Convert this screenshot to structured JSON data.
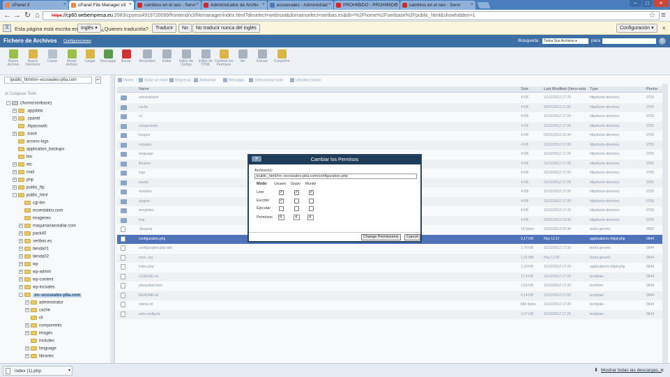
{
  "browser": {
    "tabs": [
      {
        "label": "cPanel X",
        "color": "#e7874b"
      },
      {
        "label": "cPanel File Manager v3",
        "color": "#e7874b"
      },
      {
        "label": "cambios en el seo - Servi",
        "color": "#cc2a2a"
      },
      {
        "label": "Administrador de Archiv",
        "color": "#cc2a2a"
      },
      {
        "label": "ecosenales - Administrad",
        "color": "#4a78b8"
      },
      {
        "label": "PROHIBIDO - PROHIBIDO",
        "color": "#cc2a2a"
      },
      {
        "label": "cambios en el seo - Servi",
        "color": "#cc2a2a"
      }
    ],
    "url_proto": "https",
    "url_host": "://cp60.webempresa.eu",
    "url_rest": ":2083/cpsess4919720099/frontend/x3/filemanager/index.html?dirselect=webroot&domainselect=seribas.es&dir=%2Fhome%2Fseribase%2Fpublic_html&showhidden=1"
  },
  "translate": {
    "prefix": "Esta página está escrita en",
    "language": "inglés",
    "question": "¿Quieres traducirla?",
    "translate_btn": "Traducir",
    "no_btn": "No",
    "never_btn": "No traducir nunca del inglés",
    "options_btn": "Configuración"
  },
  "app": {
    "title": "Fichero de Archivos",
    "settings_link": "Configuraciones",
    "search_label": "Búsqueda",
    "search_scope": "Todos Sus Archivos",
    "search_for": "para"
  },
  "toolbar": [
    {
      "name": "new-file",
      "label": "Nuevo Archivo",
      "color": "#9bbf4a"
    },
    {
      "name": "new-folder",
      "label": "Nuevo Directorio",
      "color": "#d9b64a"
    },
    {
      "name": "copy",
      "label": "Copiar",
      "color": "#b8c2cc"
    },
    {
      "name": "move",
      "label": "Mover Archivo",
      "color": "#9bbf4a"
    },
    {
      "name": "upload",
      "label": "Cargar",
      "color": "#d9b64a"
    },
    {
      "name": "download",
      "label": "Descargar",
      "color": "#5a9a4a"
    },
    {
      "name": "delete",
      "label": "Borrar",
      "color": "#cc3333"
    },
    {
      "name": "rename",
      "label": "Renombre",
      "color": "#a8b3bf"
    },
    {
      "name": "edit",
      "label": "Editar",
      "color": "#a8b3bf"
    },
    {
      "name": "code-edit",
      "label": "Editor de Código",
      "color": "#a8b3bf"
    },
    {
      "name": "html-edit",
      "label": "Editor de HTML",
      "color": "#a8b3bf"
    },
    {
      "name": "permissions",
      "label": "Cambiar los Permisos",
      "color": "#d9b64a"
    },
    {
      "name": "view",
      "label": "Ver",
      "color": "#a8b3bf"
    },
    {
      "name": "extract",
      "label": "Extraer",
      "color": "#a8b3bf"
    },
    {
      "name": "compress",
      "label": "Comprimir",
      "color": "#d9b64a"
    }
  ],
  "left": {
    "path": "/public_html/xn--ecoseales-p6a.com",
    "collapse_all": "Colapsar Todo",
    "tree": [
      {
        "label": "(/home/seribase)",
        "depth": 0,
        "pm": "-"
      },
      {
        "label": ".appdata",
        "depth": 1,
        "pm": "+"
      },
      {
        "label": ".cpanel",
        "depth": 1,
        "pm": "+"
      },
      {
        "label": ".htpasswds",
        "depth": 1,
        "pm": ""
      },
      {
        "label": ".trash",
        "depth": 1,
        "pm": "+"
      },
      {
        "label": "access-logs",
        "depth": 1,
        "pm": ""
      },
      {
        "label": "application_backups",
        "depth": 1,
        "pm": ""
      },
      {
        "label": "bin",
        "depth": 1,
        "pm": ""
      },
      {
        "label": "etc",
        "depth": 1,
        "pm": "+"
      },
      {
        "label": "mail",
        "depth": 1,
        "pm": "+"
      },
      {
        "label": "php",
        "depth": 1,
        "pm": "+"
      },
      {
        "label": "public_ftp",
        "depth": 1,
        "pm": "+"
      },
      {
        "label": "public_html",
        "depth": 1,
        "pm": "-"
      },
      {
        "label": "cgi-bin",
        "depth": 2,
        "pm": ""
      },
      {
        "label": "ecoestatico.com",
        "depth": 2,
        "pm": ""
      },
      {
        "label": "imagenes",
        "depth": 2,
        "pm": ""
      },
      {
        "label": "maquinariaestallar.com",
        "depth": 2,
        "pm": "+"
      },
      {
        "label": "pack40",
        "depth": 2,
        "pm": "+"
      },
      {
        "label": "seribas.es",
        "depth": 2,
        "pm": "+"
      },
      {
        "label": "tienda01",
        "depth": 2,
        "pm": "+"
      },
      {
        "label": "tienda02",
        "depth": 2,
        "pm": "+"
      },
      {
        "label": "wp",
        "depth": 2,
        "pm": "+"
      },
      {
        "label": "wp-admin",
        "depth": 2,
        "pm": "+"
      },
      {
        "label": "wp-content",
        "depth": 2,
        "pm": "+"
      },
      {
        "label": "wp-includes",
        "depth": 2,
        "pm": "+"
      },
      {
        "label": "xn--ecoseales-p6a.com",
        "depth": 2,
        "pm": "-",
        "selected": true
      },
      {
        "label": "administrator",
        "depth": 3,
        "pm": "+"
      },
      {
        "label": "cache",
        "depth": 3,
        "pm": "+"
      },
      {
        "label": "cli",
        "depth": 3,
        "pm": ""
      },
      {
        "label": "components",
        "depth": 3,
        "pm": "+"
      },
      {
        "label": "images",
        "depth": 3,
        "pm": "+"
      },
      {
        "label": "includes",
        "depth": 3,
        "pm": ""
      },
      {
        "label": "language",
        "depth": 3,
        "pm": "+"
      },
      {
        "label": "libraries",
        "depth": 3,
        "pm": "+"
      }
    ]
  },
  "actions": [
    "Home",
    "Subir un nivel",
    "Regresar",
    "Adelantar",
    "Recargar",
    "Seleccionar todo",
    "Unselect todos"
  ],
  "columns": {
    "name": "Name",
    "size": "Size",
    "modified": "Last Modified (Hora está",
    "type": "Type",
    "perms": "Perms"
  },
  "files": [
    {
      "name": "administrator",
      "size": "4 KB",
      "mod": "31/12/2012 17:29",
      "type": "httpd/unix-directory",
      "perms": "0755",
      "kind": "dir"
    },
    {
      "name": "cache",
      "size": "4 KB",
      "mod": "04/01/2013 11:05",
      "type": "httpd/unix-directory",
      "perms": "0755",
      "kind": "dir"
    },
    {
      "name": "cli",
      "size": "4 KB",
      "mod": "31/12/2012 17:29",
      "type": "httpd/unix-directory",
      "perms": "0755",
      "kind": "dir"
    },
    {
      "name": "components",
      "size": "4 KB",
      "mod": "31/12/2012 17:29",
      "type": "httpd/unix-directory",
      "perms": "0755",
      "kind": "dir"
    },
    {
      "name": "images",
      "size": "4 KB",
      "mod": "03/01/2013 10:34",
      "type": "httpd/unix-directory",
      "perms": "0755",
      "kind": "dir"
    },
    {
      "name": "includes",
      "size": "4 KB",
      "mod": "31/12/2012 17:29",
      "type": "httpd/unix-directory",
      "perms": "0755",
      "kind": "dir"
    },
    {
      "name": "language",
      "size": "4 KB",
      "mod": "31/12/2012 17:29",
      "type": "httpd/unix-directory",
      "perms": "0755",
      "kind": "dir"
    },
    {
      "name": "libraries",
      "size": "4 KB",
      "mod": "31/12/2012 17:29",
      "type": "httpd/unix-directory",
      "perms": "0755",
      "kind": "dir"
    },
    {
      "name": "logs",
      "size": "4 KB",
      "mod": "31/12/2012 17:29",
      "type": "httpd/unix-directory",
      "perms": "0755",
      "kind": "dir"
    },
    {
      "name": "media",
      "size": "4 KB",
      "mod": "31/12/2012 17:29",
      "type": "httpd/unix-directory",
      "perms": "0755",
      "kind": "dir"
    },
    {
      "name": "modules",
      "size": "4 KB",
      "mod": "31/12/2012 17:29",
      "type": "httpd/unix-directory",
      "perms": "0755",
      "kind": "dir"
    },
    {
      "name": "plugins",
      "size": "4 KB",
      "mod": "31/12/2012 17:29",
      "type": "httpd/unix-directory",
      "perms": "0755",
      "kind": "dir"
    },
    {
      "name": "templates",
      "size": "4 KB",
      "mod": "31/12/2012 17:29",
      "type": "httpd/unix-directory",
      "perms": "0755",
      "kind": "dir"
    },
    {
      "name": "tmp",
      "size": "4 KB",
      "mod": "02/01/2013 13:43",
      "type": "httpd/unix-directory",
      "perms": "0755",
      "kind": "dir"
    },
    {
      "name": ".ftpquota",
      "size": "15 bytes",
      "mod": "01/01/2013 00:44",
      "type": "text/x-generic",
      "perms": "0600",
      "kind": "doc"
    },
    {
      "name": "configuration.php",
      "size": "2,17 KB",
      "mod": "Hoy 11:17",
      "type": "application/x-httpd-php",
      "perms": "0644",
      "kind": "doc",
      "selected": true
    },
    {
      "name": "configuration.php-dist",
      "size": "1,76 KB",
      "mod": "31/12/2012 17:29",
      "type": "text/x-generic",
      "perms": "0644",
      "kind": "doc"
    },
    {
      "name": "error_log",
      "size": "1,31 MB",
      "mod": "Hoy 11:58",
      "type": "text/x-generic",
      "perms": "0644",
      "kind": "doc"
    },
    {
      "name": "index.php",
      "size": "1,29 KB",
      "mod": "31/12/2012 17:29",
      "type": "application/x-httpd-php",
      "perms": "0644",
      "kind": "doc"
    },
    {
      "name": "LICENSE.txt",
      "size": "17,4 KB",
      "mod": "31/12/2012 17:29",
      "type": "text/plain",
      "perms": "0644",
      "kind": "doc"
    },
    {
      "name": "privacidad.html",
      "size": "1,53 KB",
      "mod": "31/12/2012 17:29",
      "type": "text/html",
      "perms": "0644",
      "kind": "doc"
    },
    {
      "name": "README.txt",
      "size": "4,14 KB",
      "mod": "31/12/2012 17:29",
      "type": "text/plain",
      "perms": "0644",
      "kind": "doc"
    },
    {
      "name": "robots.txt",
      "size": "865 bytes",
      "mod": "31/12/2012 17:29",
      "type": "text/plain",
      "perms": "0644",
      "kind": "doc"
    },
    {
      "name": "web.config.txt",
      "size": "1,67 KB",
      "mod": "31/12/2012 17:29",
      "type": "text/plain",
      "perms": "0644",
      "kind": "doc"
    }
  ],
  "dialog": {
    "title": "Cambiar los Permisos",
    "files_label": "Archivo(s):",
    "file_value": "/public_html/xn--ecoseales-p6a.com/configuration.php",
    "mode_label": "Modo",
    "user_label": "Usuario",
    "group_label": "Grupo",
    "world_label": "Mundo",
    "read_label": "Leer",
    "write_label": "Escribir",
    "exec_label": "Ejecutar",
    "perms_label": "Permisos",
    "perm_user": "6",
    "perm_group": "4",
    "perm_world": "4",
    "checks": [
      [
        true,
        true,
        true
      ],
      [
        true,
        false,
        false
      ],
      [
        false,
        false,
        false
      ]
    ],
    "change_btn": "Change Permissions",
    "cancel_btn": "Cancel"
  },
  "download": {
    "file": "index (1).php",
    "show_all": "Mostrar todas las descargas..."
  }
}
